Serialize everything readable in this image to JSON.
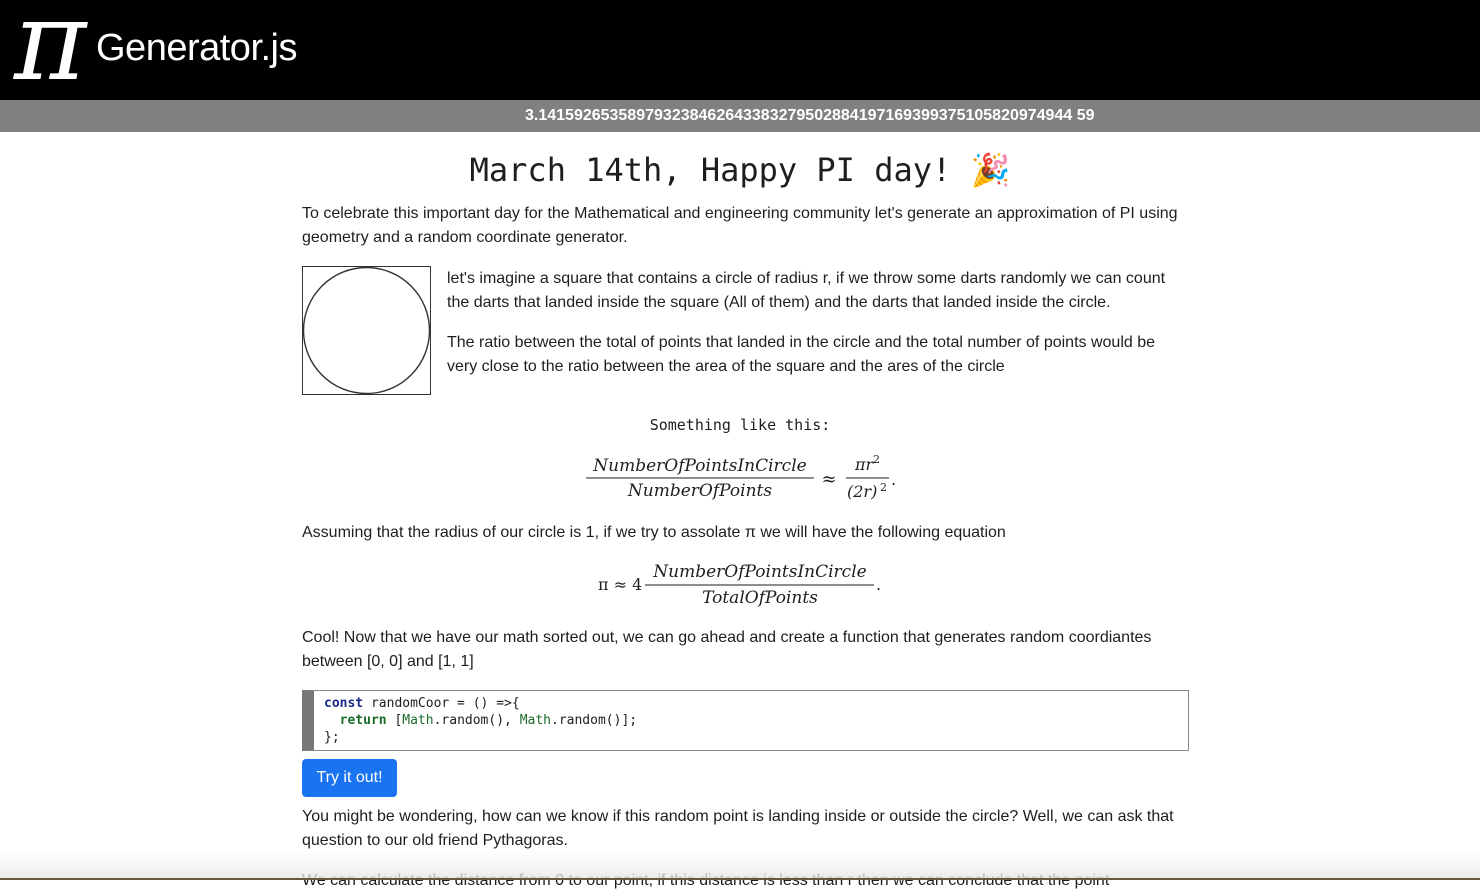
{
  "header": {
    "logo_symbol": "π",
    "logo_text": "Generator.js",
    "pi_digits": "3.141592653589793238462643383279502884197169399375105820974944 59"
  },
  "title": {
    "text": "March 14th, Happy PI day!",
    "emoji": "🎉"
  },
  "content": {
    "intro": "To celebrate this important day for the Mathematical and engineering community let's generate an approximation of PI using geometry and a random coordinate generator.",
    "darts_text": "let's imagine a square that contains a circle of radius r, if we throw some darts randomly we can count the darts that landed inside the square (All of them) and the darts that landed inside the circle.",
    "ratio_text": "The ratio between the total of points that landed in the circle and the total number of points would be very close to the ratio between the area of the square and the ares of the circle",
    "caption": "Something like this:",
    "assume_text": "Assuming that the radius of our circle is 1, if we try to assolate π we will have the following equation",
    "cool_text": "Cool! Now that we have our math sorted out, we can go ahead and create a function that generates random coordiantes between [0, 0] and [1, 1]",
    "wonder_text": "You might be wondering, how can we know if this random point is landing inside or outside the circle? Well, we can ask that question to our old friend Pythagoras.",
    "cut_text": "We can calculate the distance from 0 to our point, if this distance is less than r then we can conclude that the point"
  },
  "formula1": {
    "numerator": "NumberOfPointsInCircle",
    "denominator": "NumberOfPoints",
    "approx": "≈",
    "rhs_numerator": "πr",
    "rhs_numerator_exp": "2",
    "rhs_denominator": "(2r)",
    "rhs_denominator_exp": "2",
    "end": "."
  },
  "formula2": {
    "lhs": "π ≈ 4",
    "numerator": "NumberOfPointsInCircle",
    "denominator": "TotalOfPoints",
    "end": "."
  },
  "code": {
    "line1_kw": "const",
    "line1_rest": " randomCoor = () =>{",
    "line2_indent": "  ",
    "line2_kw": "return",
    "line2_open": " [",
    "line2_obj1": "Math",
    "line2_mid": ".random(), ",
    "line2_obj2": "Math",
    "line2_end": ".random()];",
    "line3": "};"
  },
  "button": {
    "try_label": "Try it out!"
  },
  "colors": {
    "header_bg": "#000000",
    "digits_bar_bg": "#808080",
    "button_bg": "#1a73f0"
  }
}
